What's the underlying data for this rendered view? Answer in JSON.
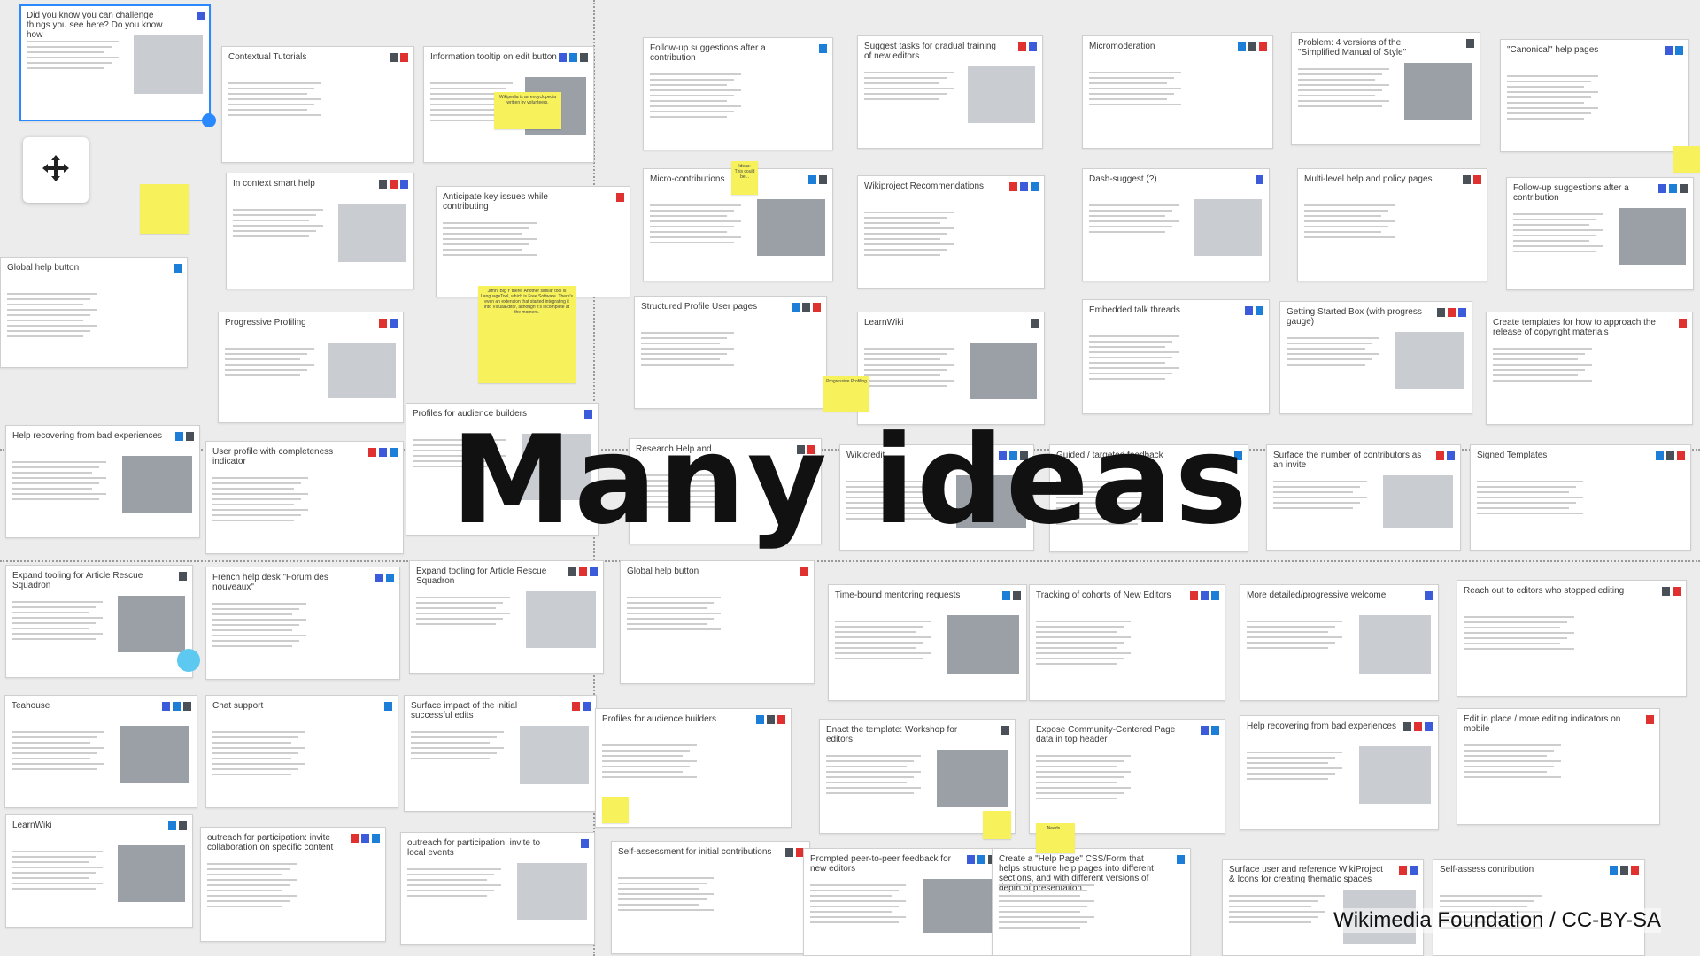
{
  "slide": {
    "title": "Many ideas",
    "credit": "Wikimedia Foundation / CC-BY-SA"
  },
  "colors": {
    "background": "#ececec",
    "sticky": "#f7f25b",
    "selection": "#2b89ff",
    "title": "#111111"
  },
  "controls": {
    "move_handle_icon": "move-arrows-icon"
  },
  "cards": [
    "Did you know you can challenge things you see here? Do you know how",
    "Contextual Tutorials",
    "Information tooltip on edit button",
    "Follow-up suggestions after a contribution",
    "Suggest tasks for gradual training of new editors",
    "Micromoderation",
    "Problem: 4 versions of the \"Simplified Manual of Style\"",
    "\"Canonical\" help pages",
    "In context smart help",
    "Anticipate key issues while contributing",
    "Micro-contributions",
    "Wikiproject Recommendations",
    "Dash-suggest (?)",
    "Multi-level help and policy pages",
    "Follow-up suggestions after a contribution",
    "Global help button",
    "Progressive Profiling",
    "Structured Profile User pages",
    "LearnWiki",
    "Embedded talk threads",
    "Getting Started Box (with progress gauge)",
    "Create templates for how to approach the release of copyright materials",
    "Help recovering from bad experiences",
    "User profile with completeness indicator",
    "Profiles for audience builders",
    "Research Help and",
    "Wikicredit",
    "Guided / targeted feedback",
    "Surface the number of contributors as an invite",
    "Signed Templates",
    "Expand tooling for Article Rescue Squadron",
    "French help desk \"Forum des nouveaux\"",
    "Expand tooling for Article Rescue Squadron",
    "Global help button",
    "Time-bound mentoring requests",
    "Tracking of cohorts of New Editors",
    "More detailed/progressive welcome",
    "Reach out to editors who stopped editing",
    "Teahouse",
    "Chat support",
    "Surface impact of the initial successful edits",
    "Profiles for audience builders",
    "Enact the template: Workshop for editors",
    "Expose Community-Centered Page data in top header",
    "Help recovering from bad experiences",
    "Edit in place / more editing indicators on mobile",
    "LearnWiki",
    "outreach for participation: invite collaboration on specific content",
    "outreach for participation: invite to local events",
    "Self-assessment for initial contributions",
    "Prompted peer-to-peer feedback for new editors",
    "Create a \"Help Page\" CSS/Form that helps structure help pages into different sections, and with different versions of depth of presentation",
    "Surface user and reference WikiProject & Icons for creating thematic spaces",
    "Self-assess contribution"
  ],
  "sticky_notes": [
    "Wikipedia is an encyclopedia written by volunteers.",
    "Jrmn: Big Y there. Another similar tool is LanguageTool, which is Free Software. There's even an extension that started integrating it into VisualEditor, although it's incomplete at the moment.",
    "Ideas: This could be...",
    "Progressive Profiling",
    "Needs..."
  ]
}
